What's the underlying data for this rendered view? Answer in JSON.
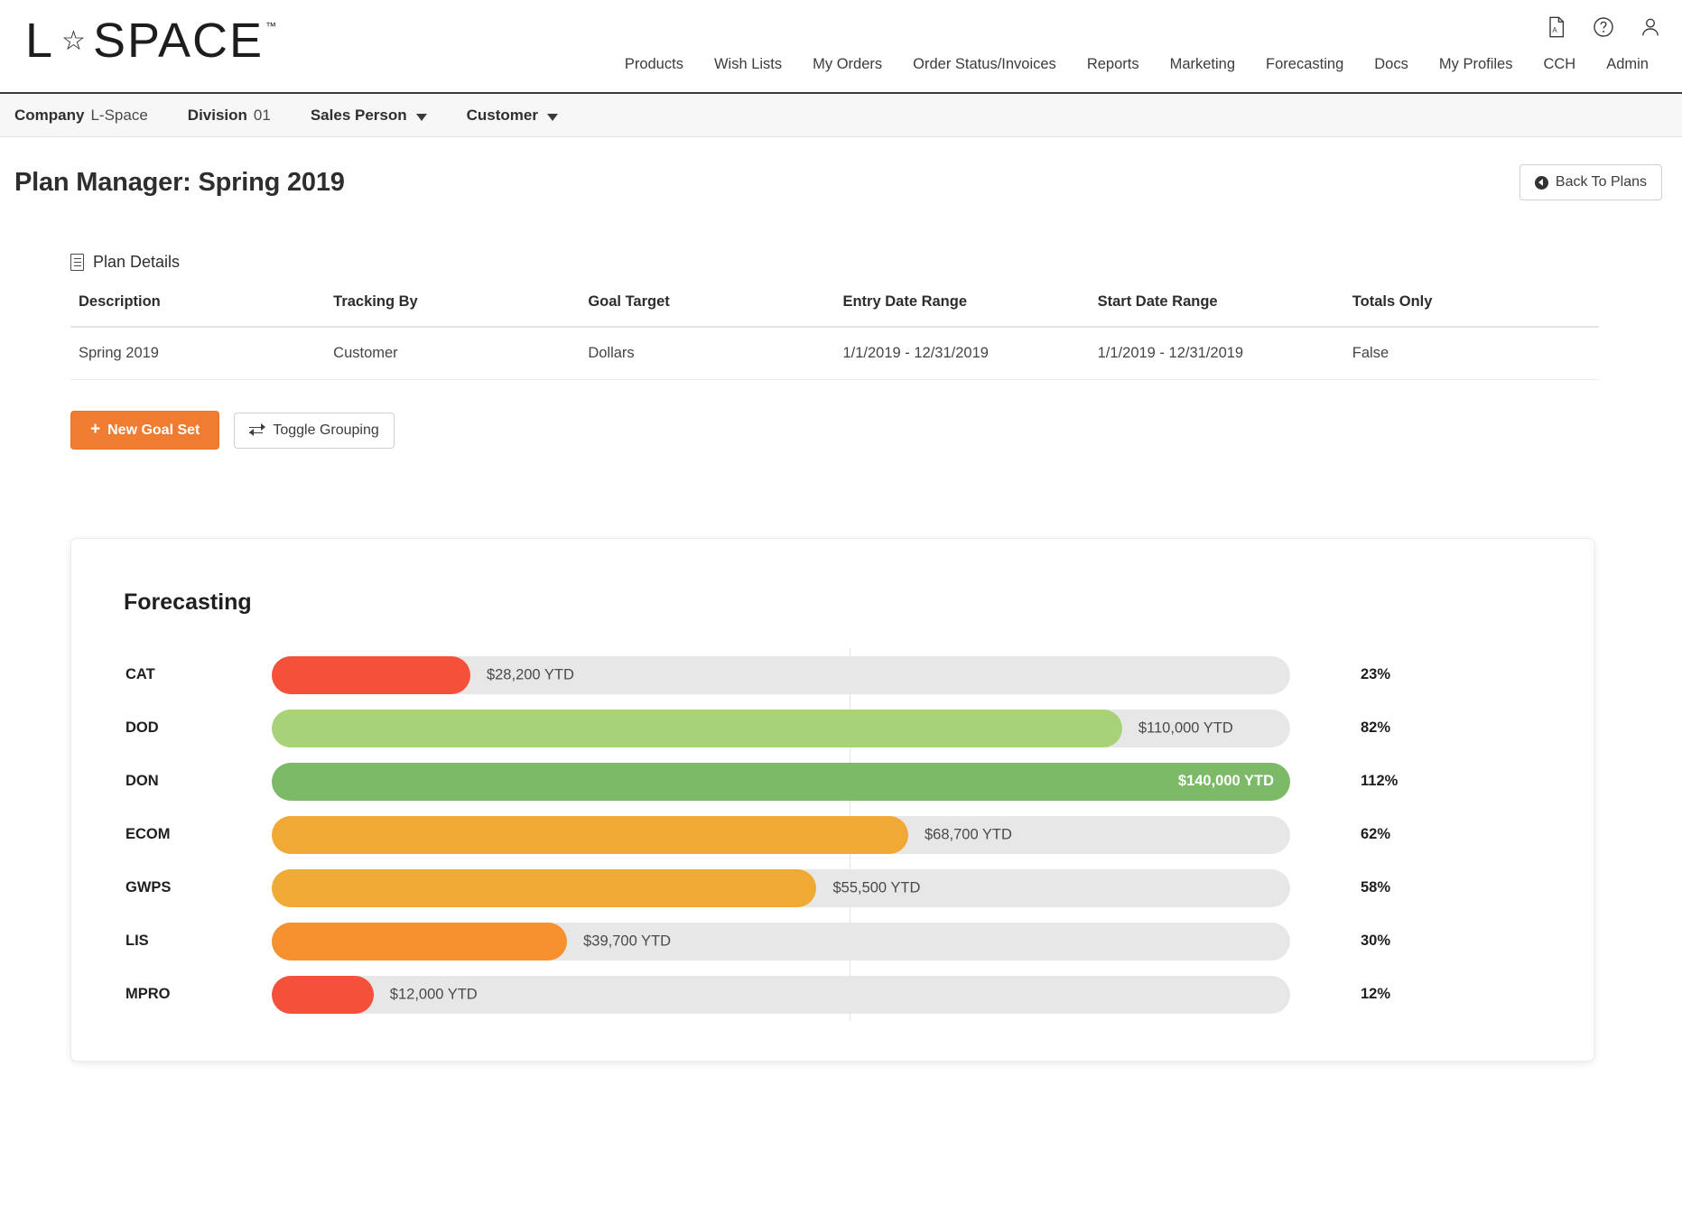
{
  "brand": {
    "logo_letter": "L",
    "logo_star": "☆",
    "logo_word": "SPACE",
    "logo_tm": "™"
  },
  "header": {
    "util_icons": [
      {
        "name": "pdf-icon",
        "glyph": "pdf"
      },
      {
        "name": "help-icon",
        "glyph": "?"
      },
      {
        "name": "user-account-icon",
        "glyph": "user"
      }
    ],
    "nav": [
      {
        "label": "Products"
      },
      {
        "label": "Wish Lists"
      },
      {
        "label": "My Orders"
      },
      {
        "label": "Order Status/Invoices"
      },
      {
        "label": "Reports"
      },
      {
        "label": "Marketing"
      },
      {
        "label": "Forecasting"
      },
      {
        "label": "Docs"
      },
      {
        "label": "My Profiles"
      },
      {
        "label": "CCH"
      },
      {
        "label": "Admin"
      }
    ]
  },
  "breadcrumb": [
    {
      "key": "Company",
      "value": "L-Space",
      "has_caret": false
    },
    {
      "key": "Division",
      "value": "01",
      "has_caret": false
    },
    {
      "key": "Sales Person",
      "value": "",
      "has_caret": true
    },
    {
      "key": "Customer",
      "value": "",
      "has_caret": true
    }
  ],
  "page": {
    "title": "Plan Manager: Spring 2019",
    "back_button": "Back To Plans"
  },
  "plan_details": {
    "section_title": "Plan Details",
    "columns": [
      "Description",
      "Tracking By",
      "Goal Target",
      "Entry Date Range",
      "Start Date Range",
      "Totals Only"
    ],
    "rows": [
      [
        "Spring 2019",
        "Customer",
        "Dollars",
        "1/1/2019 - 12/31/2019",
        "1/1/2019 - 12/31/2019",
        "False"
      ]
    ]
  },
  "actions": {
    "new_goal_set": "New Goal Set",
    "new_goal_set_icon": "+",
    "toggle_grouping": "Toggle Grouping"
  },
  "chart_data": {
    "type": "bar",
    "title": "Forecasting",
    "orientation": "horizontal",
    "xlabel": "",
    "ylabel": "",
    "grid": false,
    "legend": false,
    "reference_line_pct": 50,
    "value_suffix": "YTD",
    "categories": [
      "CAT",
      "DOD",
      "DON",
      "ECOM",
      "GWPS",
      "LIS",
      "MPRO"
    ],
    "values": [
      28200,
      110000,
      140000,
      68700,
      55500,
      39700,
      12000
    ],
    "percents": [
      23,
      82,
      112,
      62,
      58,
      30,
      12
    ],
    "bars": [
      {
        "category": "CAT",
        "value": 28200,
        "value_label": "$28,200 YTD",
        "percent_label": "23%",
        "percent": 23,
        "fill_pct": 19.5,
        "color": "#f4503a",
        "label_inside": false
      },
      {
        "category": "DOD",
        "value": 110000,
        "value_label": "$110,000 YTD",
        "percent_label": "82%",
        "percent": 82,
        "fill_pct": 83.5,
        "color": "#a8d277",
        "label_inside": false
      },
      {
        "category": "DON",
        "value": 140000,
        "value_label": "$140,000 YTD",
        "percent_label": "112%",
        "percent": 112,
        "fill_pct": 100,
        "color": "#7cba68",
        "label_inside": true
      },
      {
        "category": "ECOM",
        "value": 68700,
        "value_label": "$68,700 YTD",
        "percent_label": "62%",
        "percent": 62,
        "fill_pct": 62.5,
        "color": "#f0a935",
        "label_inside": false
      },
      {
        "category": "GWPS",
        "value": 55500,
        "value_label": "$55,500 YTD",
        "percent_label": "58%",
        "percent": 58,
        "fill_pct": 53.5,
        "color": "#f0a935",
        "label_inside": false
      },
      {
        "category": "LIS",
        "value": 39700,
        "value_label": "$39,700 YTD",
        "percent_label": "30%",
        "percent": 30,
        "fill_pct": 29,
        "color": "#f7902e",
        "label_inside": false
      },
      {
        "category": "MPRO",
        "value": 12000,
        "value_label": "$12,000 YTD",
        "percent_label": "12%",
        "percent": 12,
        "fill_pct": 10,
        "color": "#f4503a",
        "label_inside": false
      }
    ]
  },
  "colors": {
    "accent": "#ef7c30",
    "red": "#f4503a",
    "orange": "#f7902e",
    "amber": "#f0a935",
    "light_green": "#a8d277",
    "green": "#7cba68",
    "track": "#e7e7e7"
  }
}
